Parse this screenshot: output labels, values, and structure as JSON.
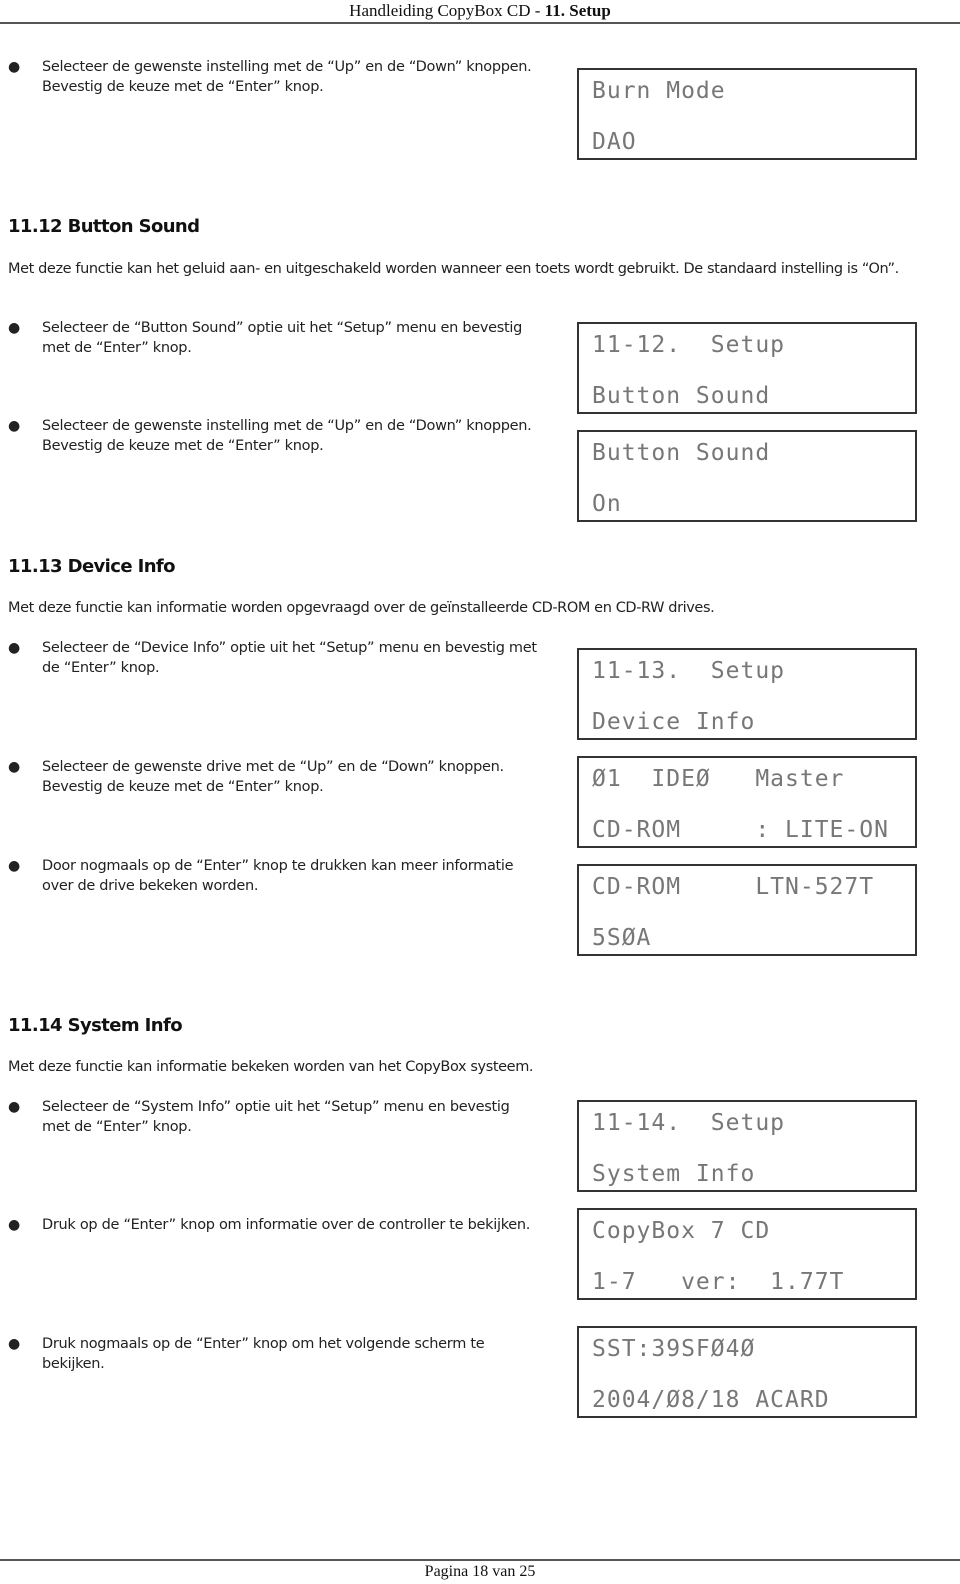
{
  "header": {
    "prefix": "Handleiding CopyBox CD - ",
    "chapter": "11. Setup"
  },
  "intro_bullet": "Selecteer de gewenste instelling met de “Up” en de “Down” knoppen. Bevestig de keuze met de “Enter” knop.",
  "intro_lcd": {
    "line1": "Burn Mode",
    "line2": "DAO"
  },
  "sections": [
    {
      "title": "11.12 Button Sound",
      "description": "Met deze functie kan het geluid aan- en uitgeschakeld worden wanneer een toets wordt gebruikt. De standaard instelling is “On”.",
      "bullets": [
        "Selecteer de “Button Sound” optie uit het “Setup” menu en bevestig met de “Enter” knop.",
        "Selecteer de gewenste instelling met de “Up” en de “Down” knoppen. Bevestig de keuze met de “Enter” knop."
      ],
      "lcds": [
        {
          "line1": "11-12.  Setup",
          "line2": "Button Sound"
        },
        {
          "line1": "Button Sound",
          "line2": "On"
        }
      ]
    },
    {
      "title": "11.13 Device Info",
      "description": "Met deze functie kan informatie worden opgevraagd over de geïnstalleerde CD-ROM en CD-RW drives.",
      "bullets": [
        "Selecteer de “Device Info” optie uit het “Setup” menu en bevestig met de “Enter” knop.",
        "Selecteer de gewenste drive met de “Up” en de “Down” knoppen. Bevestig de keuze met de “Enter” knop.",
        "Door nogmaals op de “Enter” knop te drukken kan meer informatie over de drive bekeken worden."
      ],
      "lcds": [
        {
          "line1": "11-13.  Setup",
          "line2": "Device Info"
        },
        {
          "line1": "Ø1  IDEØ   Master",
          "line2": "CD-ROM     : LITE-ON"
        },
        {
          "line1": "CD-ROM     LTN-527T",
          "line2": "5SØA"
        }
      ]
    },
    {
      "title": "11.14 System Info",
      "description": "Met deze functie kan informatie bekeken worden van het CopyBox systeem.",
      "bullets": [
        "Selecteer de “System Info” optie uit het “Setup” menu en bevestig met de “Enter” knop.",
        "Druk op de “Enter” knop om informatie over de controller te bekijken.",
        "Druk nogmaals op de “Enter” knop om het volgende scherm te bekijken."
      ],
      "lcds": [
        {
          "line1": "11-14.  Setup",
          "line2": "System Info"
        },
        {
          "line1": "CopyBox 7 CD",
          "line2": "1-7   ver:  1.77T"
        },
        {
          "line1": "SST:39SFØ4Ø",
          "line2": "2004/Ø8/18 ACARD"
        }
      ]
    }
  ],
  "footer": {
    "page_label": "Pagina 18 van 25"
  }
}
